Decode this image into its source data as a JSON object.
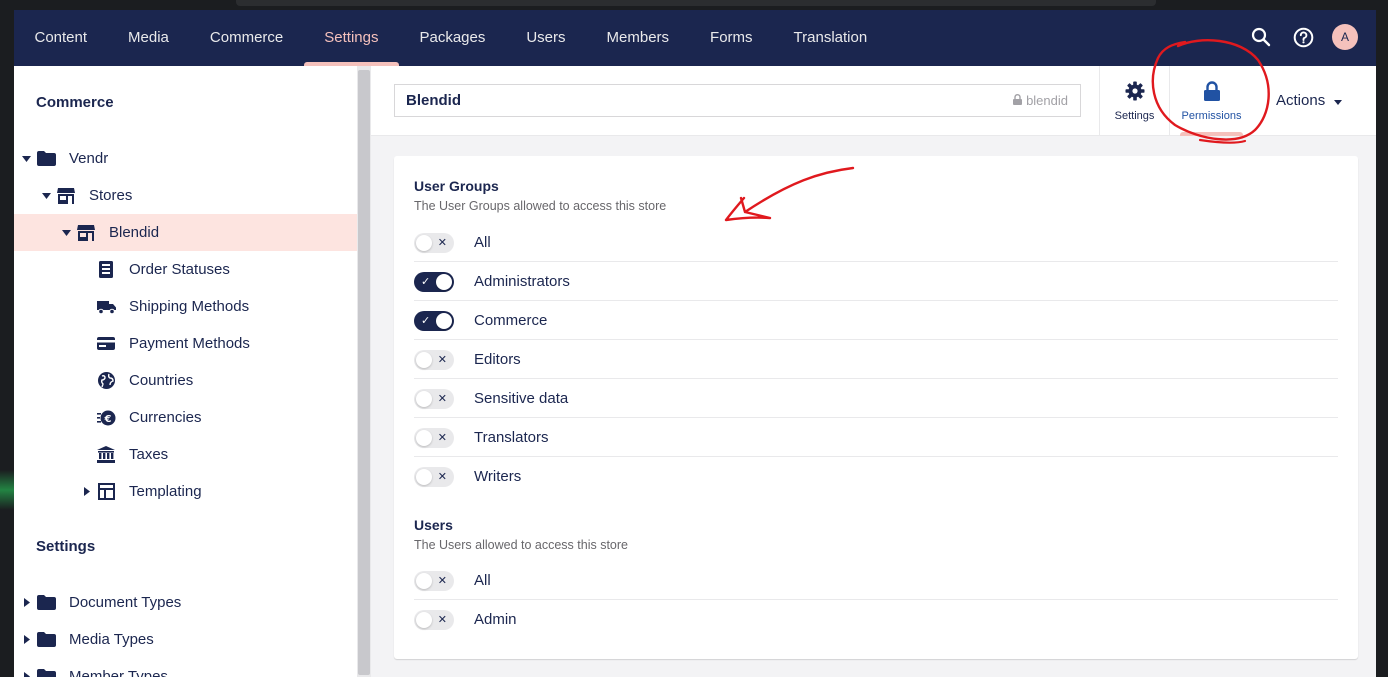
{
  "nav": {
    "items": [
      {
        "label": "Content",
        "active": false
      },
      {
        "label": "Media",
        "active": false
      },
      {
        "label": "Commerce",
        "active": false
      },
      {
        "label": "Settings",
        "active": true
      },
      {
        "label": "Packages",
        "active": false
      },
      {
        "label": "Users",
        "active": false
      },
      {
        "label": "Members",
        "active": false
      },
      {
        "label": "Forms",
        "active": false
      },
      {
        "label": "Translation",
        "active": false
      }
    ],
    "avatar_initial": "A"
  },
  "sidebar": {
    "commerce_title": "Commerce",
    "settings_title": "Settings",
    "tree": [
      {
        "label": "Vendr",
        "icon": "folder-icon"
      },
      {
        "label": "Stores",
        "icon": "store-icon"
      },
      {
        "label": "Blendid",
        "icon": "store-icon",
        "selected": true
      },
      {
        "label": "Order Statuses",
        "icon": "order-status-icon"
      },
      {
        "label": "Shipping Methods",
        "icon": "truck-icon"
      },
      {
        "label": "Payment Methods",
        "icon": "credit-card-icon"
      },
      {
        "label": "Countries",
        "icon": "globe-icon"
      },
      {
        "label": "Currencies",
        "icon": "currency-icon"
      },
      {
        "label": "Taxes",
        "icon": "bank-icon"
      },
      {
        "label": "Templating",
        "icon": "layout-icon"
      }
    ],
    "settings_tree": [
      {
        "label": "Document Types",
        "icon": "folder-icon"
      },
      {
        "label": "Media Types",
        "icon": "folder-icon"
      },
      {
        "label": "Member Types",
        "icon": "folder-icon"
      }
    ]
  },
  "editor": {
    "name": "Blendid",
    "alias": "blendid",
    "tabs": [
      {
        "label": "Settings",
        "icon": "gear-icon",
        "active": false
      },
      {
        "label": "Permissions",
        "icon": "lock-icon",
        "active": true
      }
    ],
    "actions_label": "Actions"
  },
  "permissions": {
    "user_groups": {
      "title": "User Groups",
      "description": "The User Groups allowed to access this store",
      "items": [
        {
          "label": "All",
          "enabled": false
        },
        {
          "label": "Administrators",
          "enabled": true
        },
        {
          "label": "Commerce",
          "enabled": true
        },
        {
          "label": "Editors",
          "enabled": false
        },
        {
          "label": "Sensitive data",
          "enabled": false
        },
        {
          "label": "Translators",
          "enabled": false
        },
        {
          "label": "Writers",
          "enabled": false
        }
      ]
    },
    "users": {
      "title": "Users",
      "description": "The Users allowed to access this store",
      "items": [
        {
          "label": "All",
          "enabled": false
        },
        {
          "label": "Admin",
          "enabled": false
        }
      ]
    }
  },
  "colors": {
    "header_bg": "#1b264f",
    "accent_pink": "#f5c1bc",
    "selected_bg": "#fde4e0",
    "active_tab": "#2152a3",
    "annotation_red": "#e0191e"
  }
}
